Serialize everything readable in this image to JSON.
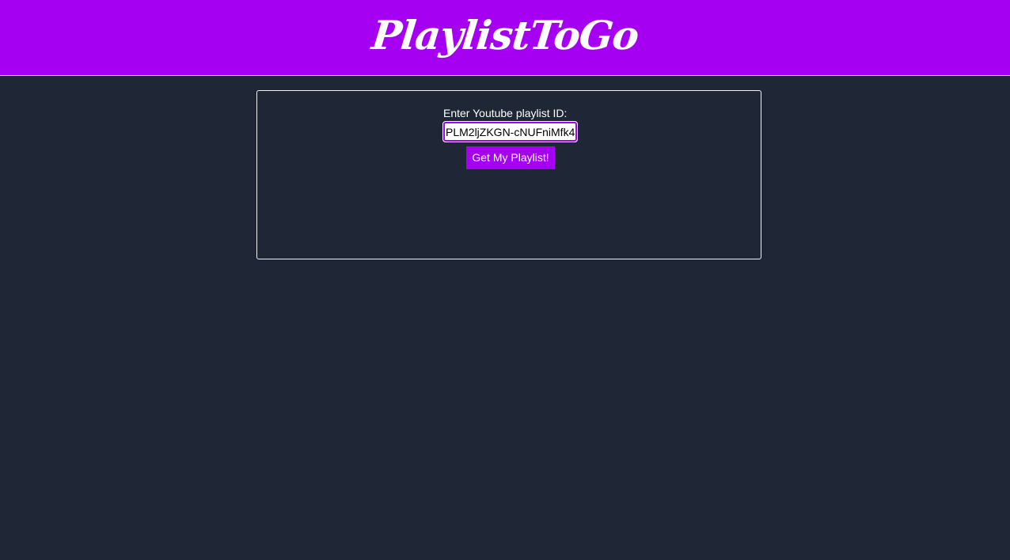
{
  "header": {
    "logo_text": "PlaylistToGo"
  },
  "form": {
    "label": "Enter Youtube playlist ID:",
    "playlist_id_value": "PLM2ljZKGN-cNUFniMfk4",
    "submit_label": "Get My Playlist!"
  },
  "colors": {
    "brand": "#a600f2",
    "background": "#1f2737",
    "text": "#ffffff"
  }
}
